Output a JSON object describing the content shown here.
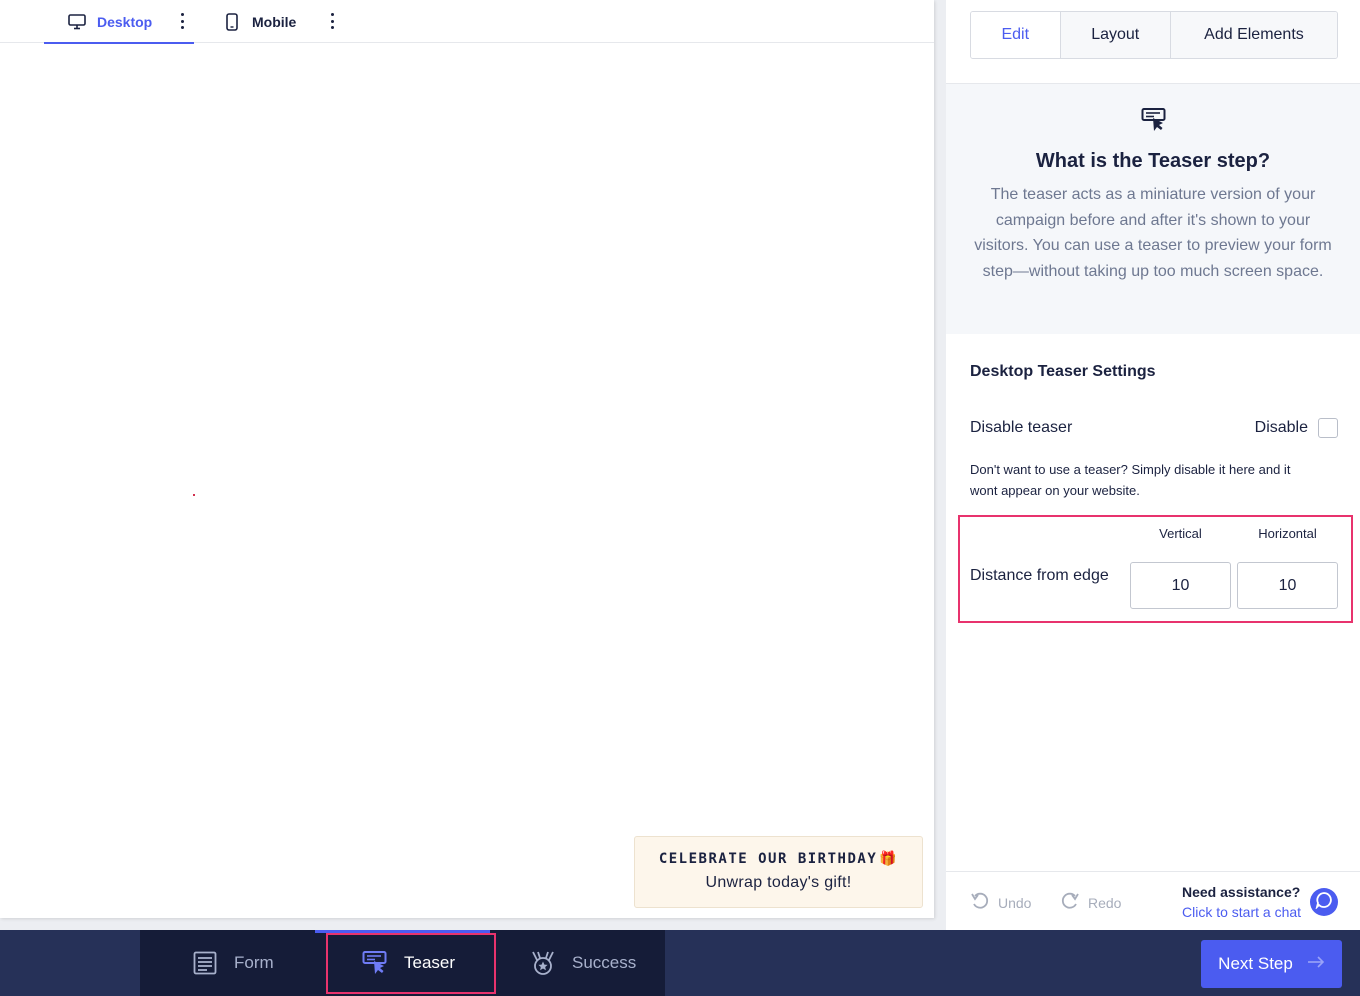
{
  "device_tabs": [
    {
      "label": "Desktop",
      "icon": "desktop-icon",
      "active": true
    },
    {
      "label": "Mobile",
      "icon": "mobile-icon",
      "active": false
    }
  ],
  "teaser_preview": {
    "title": "CELEBRATE OUR BIRTHDAY",
    "title_emoji": "🎁",
    "subtitle": "Unwrap today's gift!"
  },
  "panel": {
    "tabs": [
      {
        "label": "Edit",
        "active": true
      },
      {
        "label": "Layout",
        "active": false
      },
      {
        "label": "Add Elements",
        "active": false
      }
    ],
    "info": {
      "icon": "teaser-icon",
      "title": "What is the Teaser step?",
      "text": "The teaser acts as a miniature version of your campaign before and after it's shown to your visitors. You can use a teaser to preview your form step—without taking up too much screen space."
    },
    "settings_title": "Desktop Teaser Settings",
    "disable_row": {
      "label": "Disable teaser",
      "checkbox_label": "Disable",
      "checked": false
    },
    "help_text": "Don't want to use a teaser? Simply disable it here and it wont appear on your website.",
    "distance": {
      "label": "Distance from edge",
      "vertical_label": "Vertical",
      "horizontal_label": "Horizontal",
      "vertical_value": "10",
      "horizontal_value": "10"
    },
    "footer": {
      "undo_label": "Undo",
      "redo_label": "Redo",
      "assist_title": "Need assistance?",
      "assist_link": "Click to start a chat"
    }
  },
  "steps": [
    {
      "label": "Form",
      "icon": "form-icon",
      "active": false
    },
    {
      "label": "Teaser",
      "icon": "teaser-icon",
      "active": true
    },
    {
      "label": "Success",
      "icon": "success-award-icon",
      "active": false
    }
  ],
  "next_button": {
    "label": "Next Step",
    "icon": "arrow-right-icon"
  },
  "colors": {
    "accent": "#4b5cf0",
    "highlight": "#e8336d",
    "bottom_bar": "#263158",
    "steps_bg": "#151c38"
  }
}
